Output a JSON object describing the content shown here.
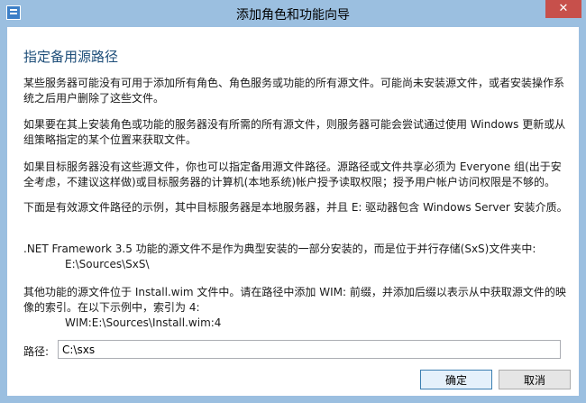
{
  "window": {
    "title": "添加角色和功能向导",
    "close_glyph": "✕"
  },
  "content": {
    "heading": "指定备用源路径",
    "paragraphs": [
      "某些服务器可能没有可用于添加所有角色、角色服务或功能的所有源文件。可能尚未安装源文件，或者安装操作系统之后用户删除了这些文件。",
      "如果要在其上安装角色或功能的服务器没有所需的所有源文件，则服务器可能会尝试通过使用 Windows 更新或从组策略指定的某个位置来获取文件。",
      "如果目标服务器没有这些源文件，你也可以指定备用源文件路径。源路径或文件共享必须为 Everyone 组(出于安全考虑，不建议这样做)或目标服务器的计算机(本地系统)帐户授予读取权限；授予用户帐户访问权限是不够的。",
      "下面是有效源文件路径的示例，其中目标服务器是本地服务器，并且 E: 驱动器包含 Windows Server 安装介质。"
    ],
    "netfx_text": ".NET Framework 3.5 功能的源文件不是作为典型安装的一部分安装的，而是位于并行存储(SxS)文件夹中:",
    "netfx_example": "E:\\Sources\\SxS\\",
    "wim_text": "其他功能的源文件位于 Install.wim 文件中。请在路径中添加 WIM: 前缀，并添加后缀以表示从中获取源文件的映像的索引。在以下示例中，索引为 4:",
    "wim_example": "WIM:E:\\Sources\\Install.wim:4"
  },
  "path": {
    "label": "路径:",
    "value": "C:\\sxs"
  },
  "buttons": {
    "ok": "确定",
    "cancel": "取消"
  }
}
